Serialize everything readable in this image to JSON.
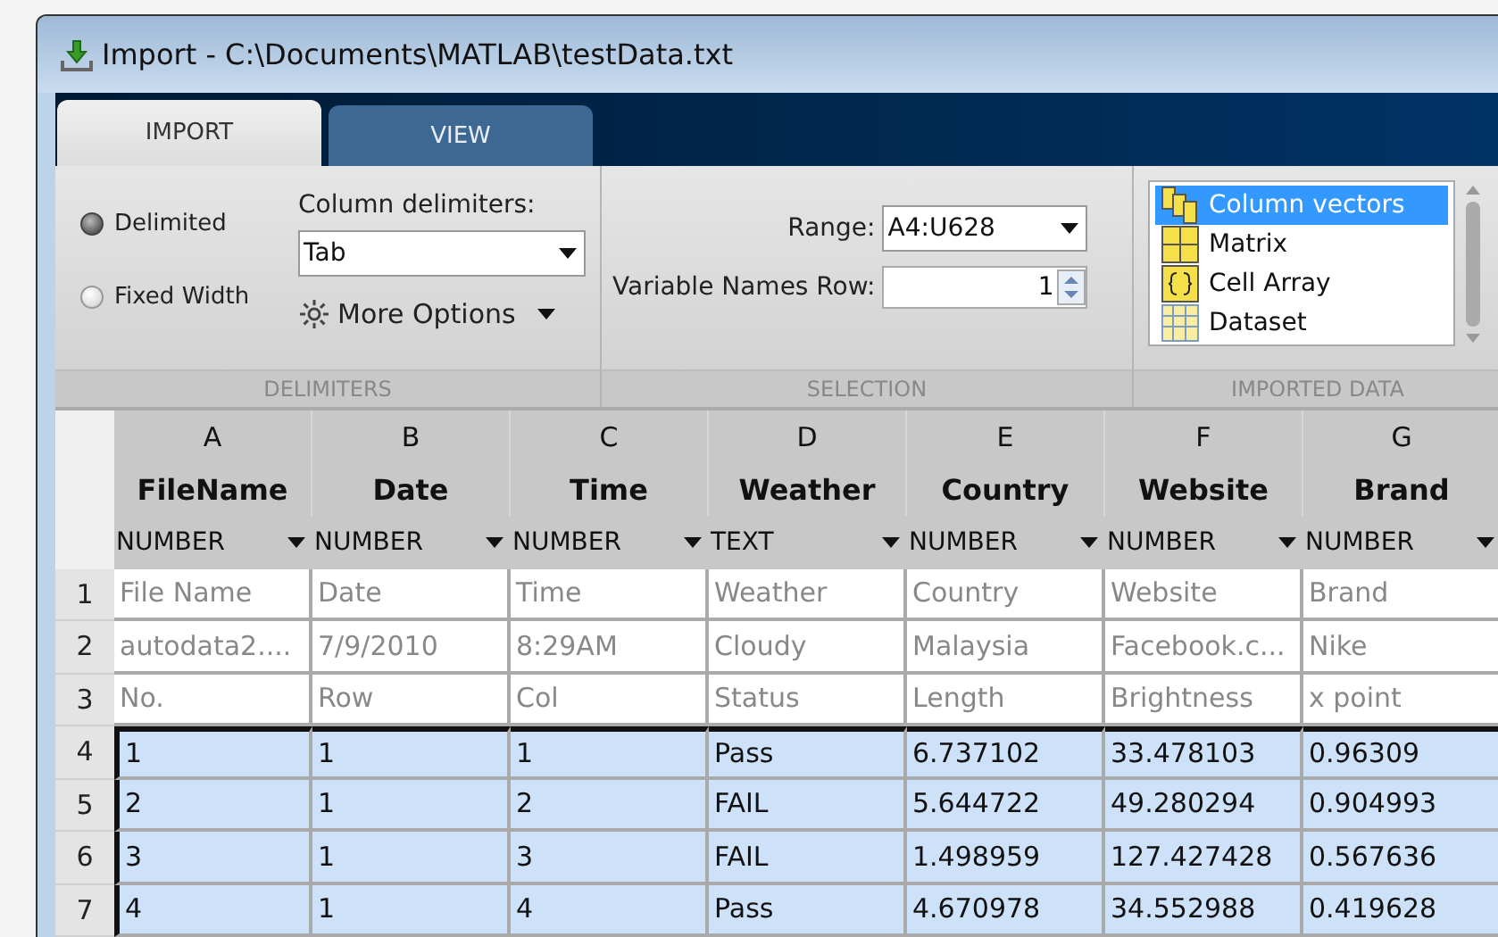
{
  "window": {
    "title": "Import - C:\\Documents\\MATLAB\\testData.txt"
  },
  "tabs": [
    {
      "label": "IMPORT",
      "selected": true
    },
    {
      "label": "VIEW",
      "selected": false
    }
  ],
  "ribbon": {
    "delimiters": {
      "options": [
        {
          "label": "Delimited",
          "selected": true
        },
        {
          "label": "Fixed Width",
          "selected": false
        }
      ],
      "column_delimiters_label": "Column delimiters:",
      "column_delimiters_value": "Tab",
      "more_options": "More Options",
      "section_label": "DELIMITERS"
    },
    "selection": {
      "range_label": "Range:",
      "range_value": "A4:U628",
      "names_row_label": "Variable Names Row:",
      "names_row_value": "1",
      "section_label": "SELECTION"
    },
    "imported_data": {
      "items": [
        {
          "label": "Column vectors",
          "kind": "vectors",
          "selected": true
        },
        {
          "label": "Matrix",
          "kind": "matrix",
          "selected": false
        },
        {
          "label": "Cell Array",
          "kind": "cell",
          "selected": false
        },
        {
          "label": "Dataset",
          "kind": "dataset",
          "selected": false
        }
      ],
      "section_label": "IMPORTED DATA"
    }
  },
  "table": {
    "columns": [
      {
        "letter": "A",
        "name": "FileName",
        "type": "NUMBER"
      },
      {
        "letter": "B",
        "name": "Date",
        "type": "NUMBER"
      },
      {
        "letter": "C",
        "name": "Time",
        "type": "NUMBER"
      },
      {
        "letter": "D",
        "name": "Weather",
        "type": "TEXT"
      },
      {
        "letter": "E",
        "name": "Country",
        "type": "NUMBER"
      },
      {
        "letter": "F",
        "name": "Website",
        "type": "NUMBER"
      },
      {
        "letter": "G",
        "name": "Brand",
        "type": "NUMBER"
      }
    ],
    "rows": [
      {
        "number": "1",
        "selected": false,
        "cells": [
          "File Name",
          "Date",
          "Time",
          "Weather",
          "Country",
          "Website",
          "Brand"
        ]
      },
      {
        "number": "2",
        "selected": false,
        "cells": [
          "autodata2....",
          "7/9/2010",
          "8:29AM",
          "Cloudy",
          "Malaysia",
          "Facebook.c...",
          "Nike"
        ]
      },
      {
        "number": "3",
        "selected": false,
        "cells": [
          "No.",
          "Row",
          "Col",
          "Status",
          "Length",
          "Brightness",
          "x point"
        ]
      },
      {
        "number": "4",
        "selected": true,
        "cells": [
          "1",
          "1",
          "1",
          "Pass",
          "6.737102",
          "33.478103",
          "0.96309"
        ]
      },
      {
        "number": "5",
        "selected": true,
        "cells": [
          "2",
          "1",
          "2",
          "FAIL",
          "5.644722",
          "49.280294",
          "0.904993"
        ]
      },
      {
        "number": "6",
        "selected": true,
        "cells": [
          "3",
          "1",
          "3",
          "FAIL",
          "1.498959",
          "127.427428",
          "0.567636"
        ]
      },
      {
        "number": "7",
        "selected": true,
        "cells": [
          "4",
          "1",
          "4",
          "Pass",
          "4.670978",
          "34.552988",
          "0.419628"
        ]
      }
    ]
  }
}
